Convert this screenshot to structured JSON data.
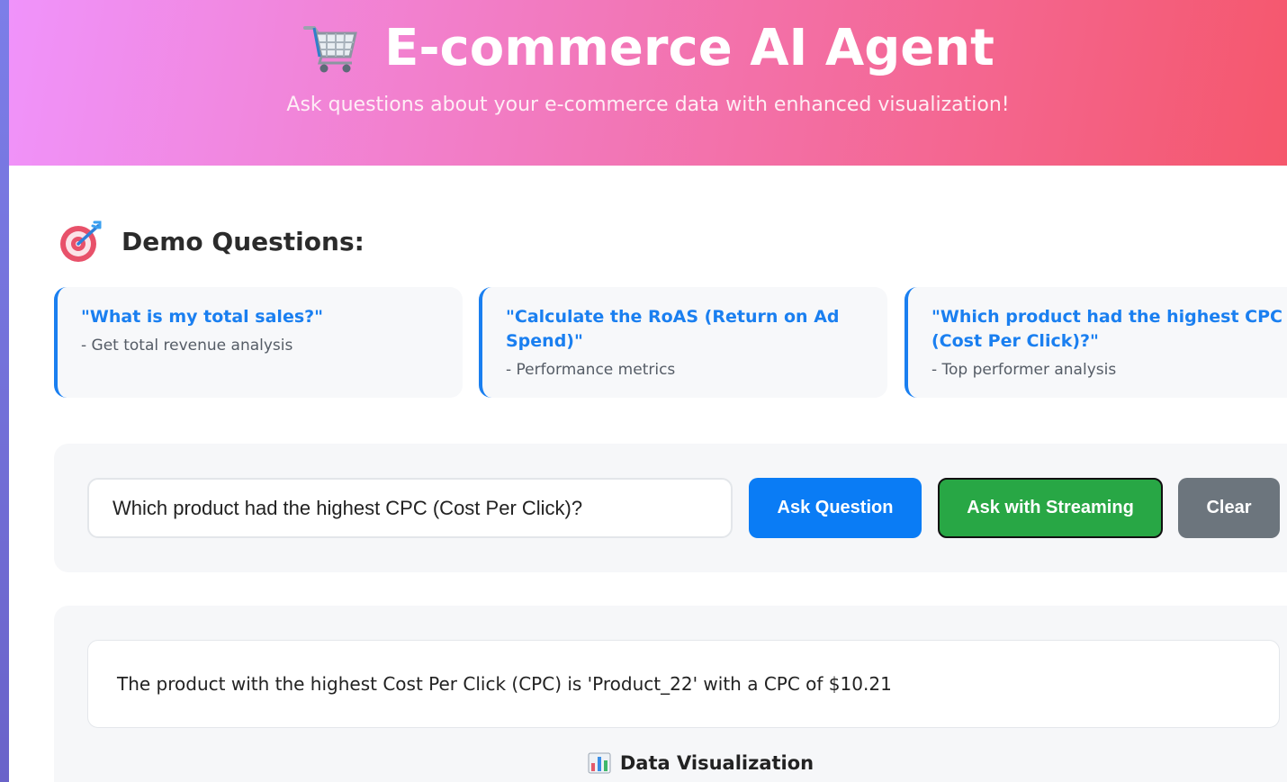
{
  "header": {
    "icon": "shopping-cart-icon",
    "title": "E-commerce AI Agent",
    "subtitle": "Ask questions about your e-commerce data with enhanced visualization!",
    "gradient_start": "#f093fb",
    "gradient_end": "#f5576c"
  },
  "demo": {
    "icon": "target-icon",
    "heading": "Demo Questions:",
    "cards": [
      {
        "question": "\"What is my total sales?\"",
        "description": "- Get total revenue analysis"
      },
      {
        "question": "\"Calculate the RoAS (Return on Ad Spend)\"",
        "description": "- Performance metrics"
      },
      {
        "question": "\"Which product had the highest CPC (Cost Per Click)?\"",
        "description": "- Top performer analysis"
      }
    ]
  },
  "input": {
    "value": "Which product had the highest CPC (Cost Per Click)?",
    "ask_label": "Ask Question",
    "stream_label": "Ask with Streaming",
    "clear_label": "Clear"
  },
  "result": {
    "answer": "The product with the highest Cost Per Click (CPC) is 'Product_22' with a CPC of $10.21",
    "viz_icon": "bar-chart-icon",
    "viz_heading": "Data Visualization"
  },
  "colors": {
    "accent_blue": "#0a7cf5",
    "stream_green": "#28a745",
    "clear_gray": "#6c757d"
  }
}
